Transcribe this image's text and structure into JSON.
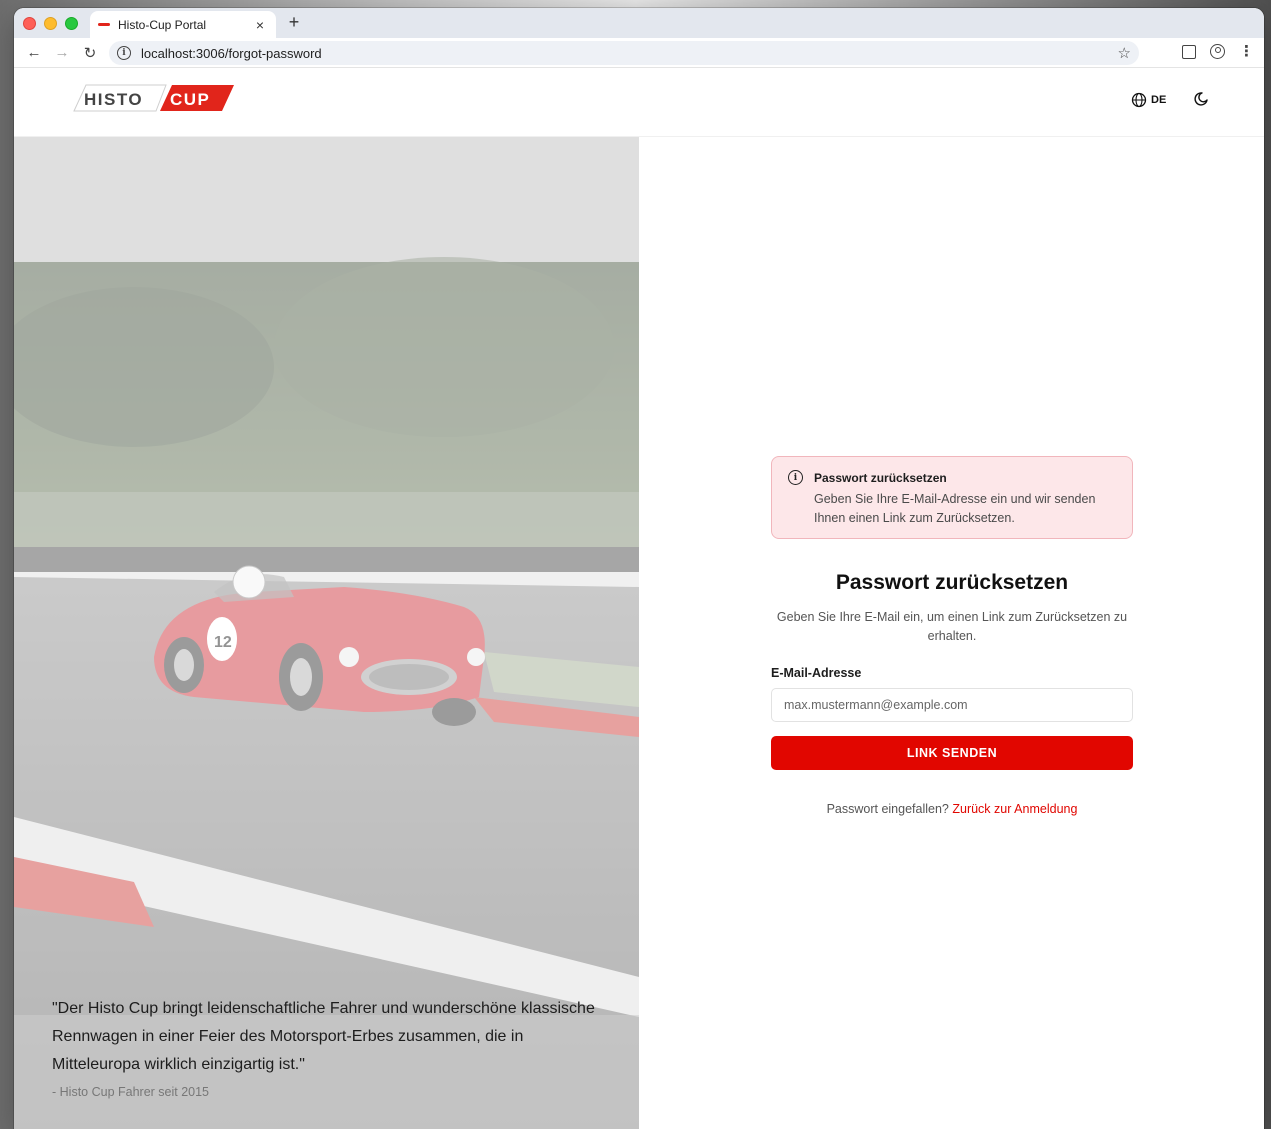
{
  "browser": {
    "tab_title": "Histo-Cup Portal",
    "tab_close": "×",
    "new_tab": "+",
    "url": "localhost:3006/forgot-password",
    "icons": [
      "back-arrow-icon",
      "forward-arrow-icon",
      "reload-icon",
      "site-info-icon",
      "bookmark-star-icon",
      "extensions-icon",
      "profile-icon",
      "browser-menu-icon"
    ]
  },
  "header": {
    "logo_left": "HISTO",
    "logo_right": "CUP",
    "language": "DE",
    "icons": [
      "globe-icon",
      "moon-icon"
    ]
  },
  "hero": {
    "quote": "\"Der Histo Cup bringt leidenschaftliche Fahrer und wunderschöne klassische Rennwagen in einer Feier des Motorsport-Erbes zusammen, die in Mitteleuropa wirklich einzigartig ist.\"",
    "author": "- Histo Cup Fahrer seit 2015",
    "car_number": "12"
  },
  "alert": {
    "title": "Passwort zurücksetzen",
    "text": "Geben Sie Ihre E-Mail-Adresse ein und wir senden Ihnen einen Link zum Zurücksetzen."
  },
  "form": {
    "title": "Passwort zurücksetzen",
    "subtitle": "Geben Sie Ihre E-Mail ein, um einen Link zum Zurücksetzen zu erhalten.",
    "email_label": "E-Mail-Adresse",
    "email_placeholder": "max.mustermann@example.com",
    "email_value": "",
    "submit_label": "LINK SENDEN",
    "back_prompt": "Passwort eingefallen?",
    "back_link": "Zurück zur Anmeldung"
  },
  "colors": {
    "brand_red": "#e10600",
    "alert_bg": "#fde7e9",
    "alert_border": "#f1b6bc"
  }
}
